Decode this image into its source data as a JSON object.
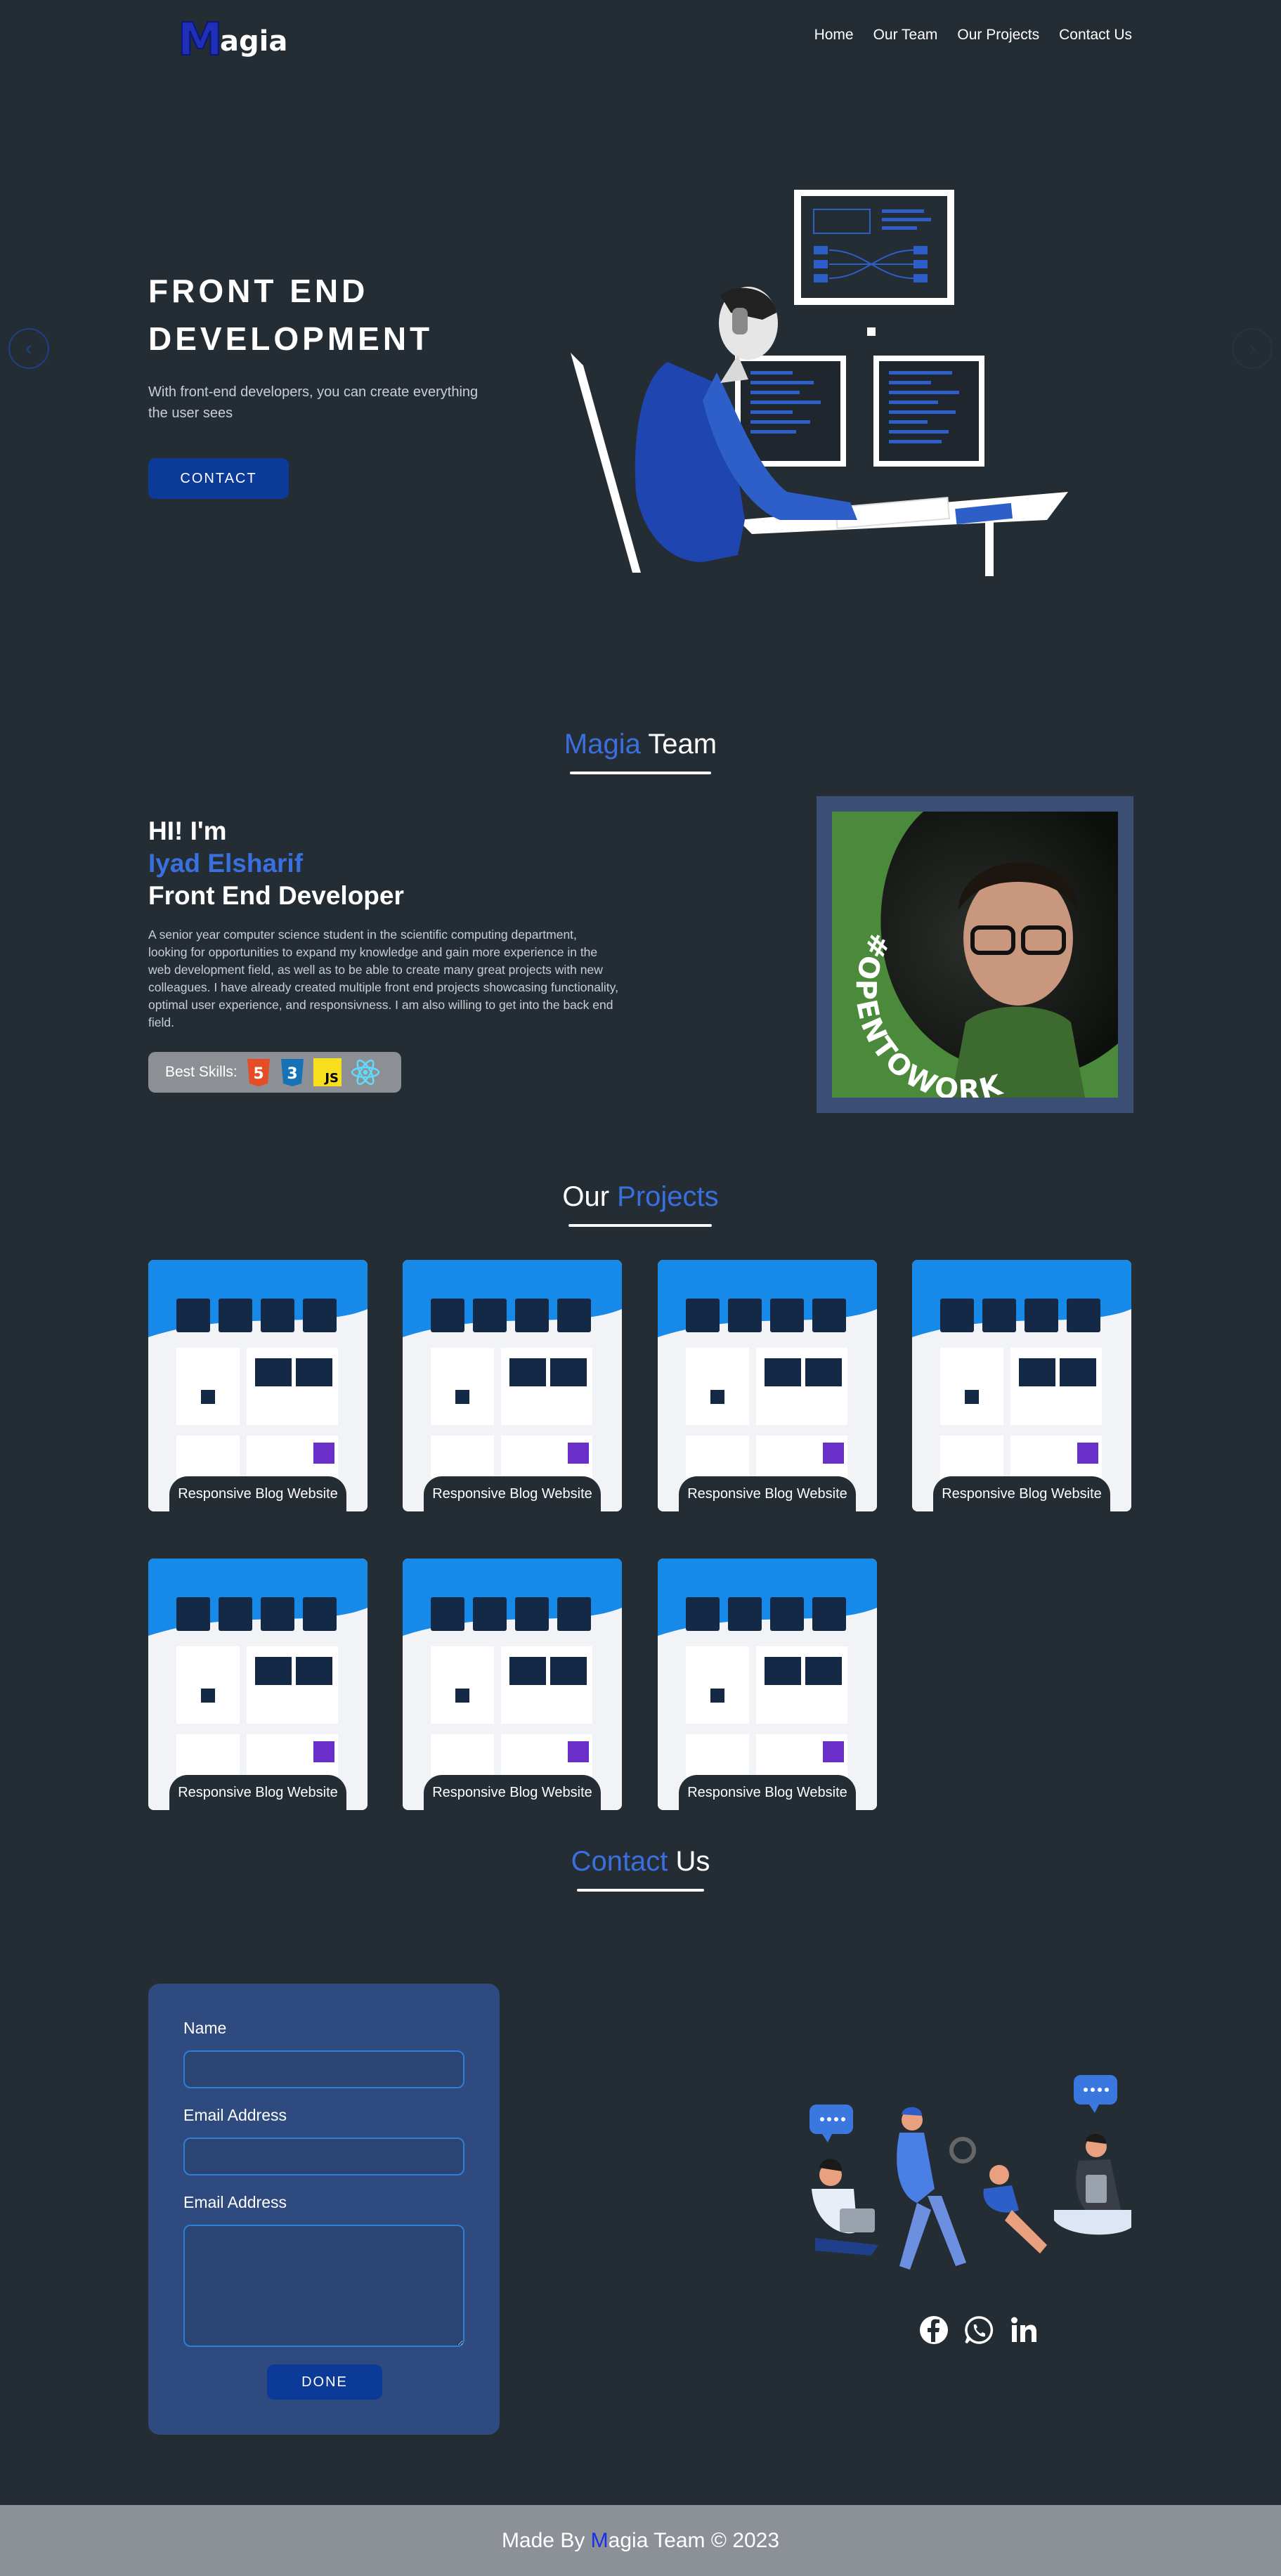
{
  "nav": {
    "logo_text": "Magia",
    "links": [
      "Home",
      "Our Team",
      "Our Projects",
      "Contact Us"
    ]
  },
  "hero": {
    "title_line1": "Front End",
    "title_line2": "Development",
    "subtitle": "With front-end developers, you can create everything the user sees",
    "button": "Contact"
  },
  "team": {
    "title_accent": "Magia",
    "title_rest": " Team",
    "greeting": "HI! I'm",
    "name": "Iyad Elsharif",
    "role": "Front End Developer",
    "description": "A senior year computer science student in the scientific computing department, looking for opportunities to expand my knowledge and gain more experience in the web development field, as well as to be able to create many great projects with new colleagues. I have already created multiple front end projects showcasing functionality, optimal user experience, and responsivness. I am also willing to get into the back end field.",
    "skills_label": "Best Skills:",
    "skills_icons": [
      "html5-icon",
      "css3-icon",
      "javascript-icon",
      "react-icon"
    ],
    "skills_badges": [
      "5",
      "3",
      "JS"
    ],
    "photo_badge": "#OPENTOWORK"
  },
  "projects": {
    "title_rest": "Our ",
    "title_accent": "Projects",
    "items": [
      {
        "label": "Responsive Blog Website"
      },
      {
        "label": "Responsive Blog Website"
      },
      {
        "label": "Responsive Blog Website"
      },
      {
        "label": "Responsive Blog Website"
      },
      {
        "label": "Responsive Blog Website"
      },
      {
        "label": "Responsive Blog Website"
      },
      {
        "label": "Responsive Blog Website"
      }
    ]
  },
  "contact": {
    "title_accent": "Contact",
    "title_rest": " Us",
    "name_label": "Name",
    "email_label": "Email Address",
    "message_label": "Email Address",
    "button": "Done",
    "social": [
      "facebook-icon",
      "whatsapp-icon",
      "linkedin-icon"
    ]
  },
  "footer": {
    "prefix": "Made By ",
    "brand_m": "M",
    "suffix": "agia Team © 2023"
  },
  "colors": {
    "background": "#252d34",
    "accent": "#3a6fe0",
    "button": "#0c3a99",
    "form": "#2e4a7e",
    "footer": "#8b9197"
  }
}
